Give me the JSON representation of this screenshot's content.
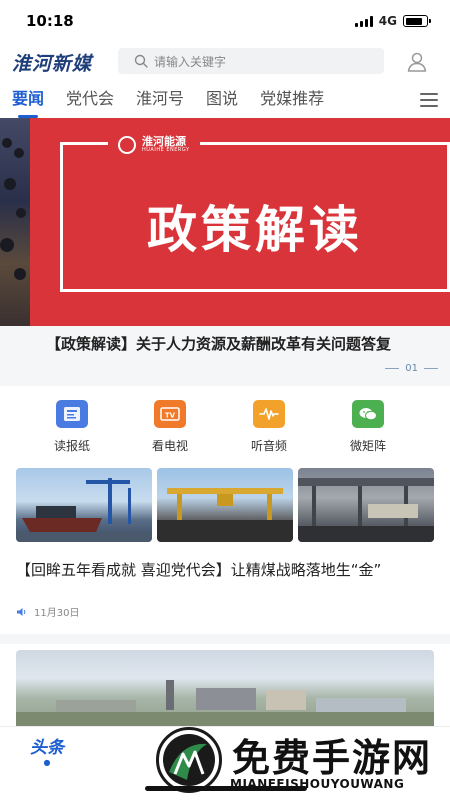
{
  "status_bar": {
    "time": "10:18",
    "network": "4G"
  },
  "header": {
    "logo_text": "淮河新媒",
    "search_placeholder": "请输入关键字"
  },
  "tabs": [
    {
      "label": "要闻",
      "active": true
    },
    {
      "label": "党代会",
      "active": false
    },
    {
      "label": "淮河号",
      "active": false
    },
    {
      "label": "图说",
      "active": false
    },
    {
      "label": "党媒推荐",
      "active": false
    }
  ],
  "banner": {
    "brand_cn": "淮河能源",
    "brand_en": "HUAIHE ENERGY",
    "slide_title": "政策解读",
    "caption": "【政策解读】关于人力资源及薪酬改革有关问题答复",
    "page_indicator": "01",
    "accent": "#d8343a"
  },
  "quick_entries": [
    {
      "label": "读报纸",
      "icon": "newspaper-icon",
      "color": "#4a7be0"
    },
    {
      "label": "看电视",
      "icon": "tv-icon",
      "color": "#f07a2a"
    },
    {
      "label": "听音频",
      "icon": "audio-icon",
      "color": "#f2a22a"
    },
    {
      "label": "微矩阵",
      "icon": "wechat-icon",
      "color": "#4cb050"
    }
  ],
  "news": [
    {
      "title": "【回眸五年看成就 喜迎党代会】让精煤战略落地生“金”",
      "date": "11月30日"
    }
  ],
  "bottom_nav": {
    "home_label": "头条"
  },
  "watermark": {
    "title": "免费手游网",
    "subtitle": "MIANFEISHOUYOUWANG"
  },
  "colors": {
    "primary": "#1d5fd0",
    "text": "#222222"
  }
}
